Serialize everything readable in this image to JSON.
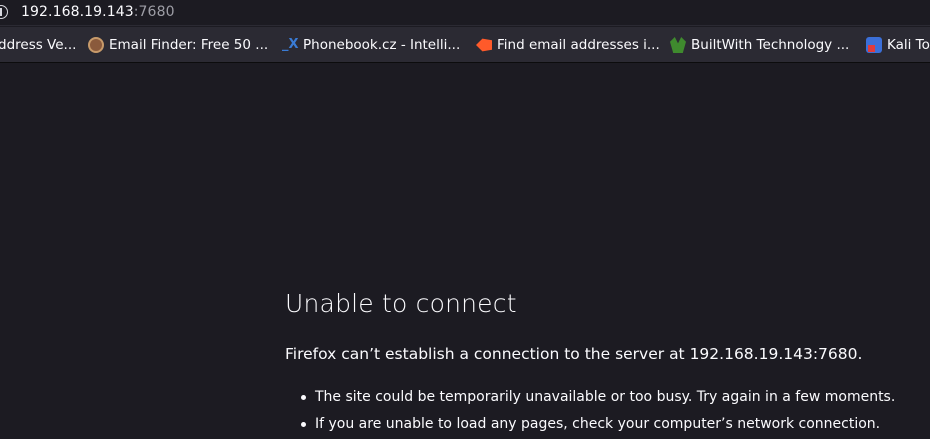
{
  "url_bar": {
    "host": "192.168.19.143",
    "port": ":7680"
  },
  "bookmarks": [
    {
      "label": "ddress Ve...",
      "icon": "none"
    },
    {
      "label": "Email Finder: Free 50 ...",
      "icon": "email-finder-icon"
    },
    {
      "label": "Phonebook.cz - Intelli...",
      "icon": "phonebook-icon"
    },
    {
      "label": "Find email addresses i...",
      "icon": "hunter-icon"
    },
    {
      "label": "BuiltWith Technology ...",
      "icon": "builtwith-icon"
    },
    {
      "label": "Kali To",
      "icon": "kali-icon"
    }
  ],
  "error": {
    "title": "Unable to connect",
    "description": "Firefox can’t establish a connection to the server at 192.168.19.143:7680.",
    "items": [
      "The site could be temporarily unavailable or too busy. Try again in a few moments.",
      "If you are unable to load any pages, check your computer’s network connection."
    ]
  },
  "colors": {
    "background": "#1c1b22",
    "toolbar": "#2b2a33",
    "text": "#fbfbfe",
    "muted": "#9e9ea6"
  }
}
